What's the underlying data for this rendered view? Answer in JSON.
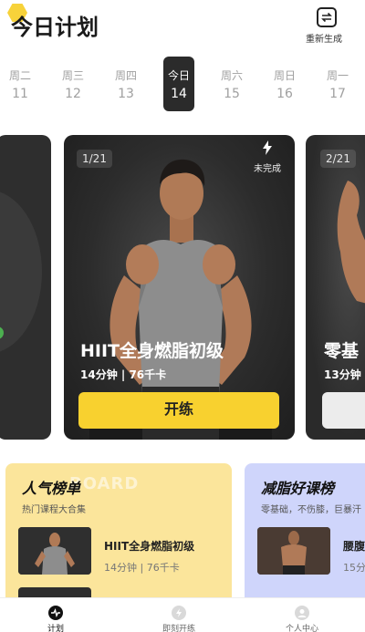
{
  "header": {
    "title": "今日计划",
    "regenerate_label": "重新生成"
  },
  "week": [
    {
      "name": "周二",
      "num": "11"
    },
    {
      "name": "周三",
      "num": "12"
    },
    {
      "name": "周四",
      "num": "13"
    },
    {
      "name": "今日",
      "num": "14",
      "active": true
    },
    {
      "name": "周六",
      "num": "15"
    },
    {
      "name": "周日",
      "num": "16"
    },
    {
      "name": "周一",
      "num": "17"
    }
  ],
  "cards": {
    "main": {
      "counter": "1/21",
      "status": "未完成",
      "title": "HIIT全身燃脂初级",
      "meta": "14分钟 | 76千卡",
      "button": "开练"
    },
    "next": {
      "counter": "2/21",
      "title": "零基",
      "meta": "13分钟 |"
    }
  },
  "panels": {
    "popular": {
      "title": "人气榜单",
      "watermark": "BOARD",
      "subtitle": "热门课程大合集",
      "item_title": "HIIT全身燃脂初级",
      "item_meta": "14分钟 | 76千卡"
    },
    "fatburn": {
      "title": "减脂好课榜",
      "subtitle": "零基础，不伤膝，巨暴汗",
      "item_title": "腰腹",
      "item_meta": "15分"
    }
  },
  "nav": [
    {
      "label": "计划",
      "active": true
    },
    {
      "label": "即刻开练"
    },
    {
      "label": "个人中心"
    }
  ],
  "colors": {
    "accent": "#f8d12f",
    "dark": "#262626"
  },
  "icons": {
    "regenerate": "refresh-swap-icon",
    "status": "lightning-icon"
  }
}
